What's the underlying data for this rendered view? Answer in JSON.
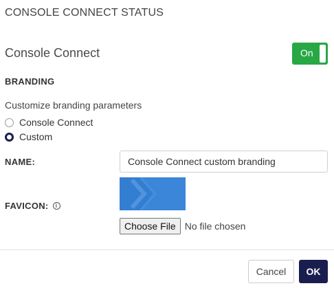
{
  "header": {
    "title": "CONSOLE CONNECT STATUS"
  },
  "status": {
    "label": "Console Connect",
    "toggle_label": "On",
    "toggle_on": true,
    "toggle_color": "#28a745"
  },
  "branding": {
    "heading": "BRANDING",
    "description": "Customize branding parameters",
    "options": [
      {
        "label": "Console Connect",
        "checked": false
      },
      {
        "label": "Custom",
        "checked": true
      }
    ]
  },
  "form": {
    "name_label": "NAME:",
    "name_value": "Console Connect custom branding",
    "favicon_label": "FAVICON:",
    "info_icon": "info-icon",
    "favicon_color": "#3b86d9",
    "choose_file_label": "Choose File",
    "no_file_text": "No file chosen"
  },
  "footer": {
    "cancel_label": "Cancel",
    "ok_label": "OK",
    "ok_color": "#1a1e4f"
  }
}
